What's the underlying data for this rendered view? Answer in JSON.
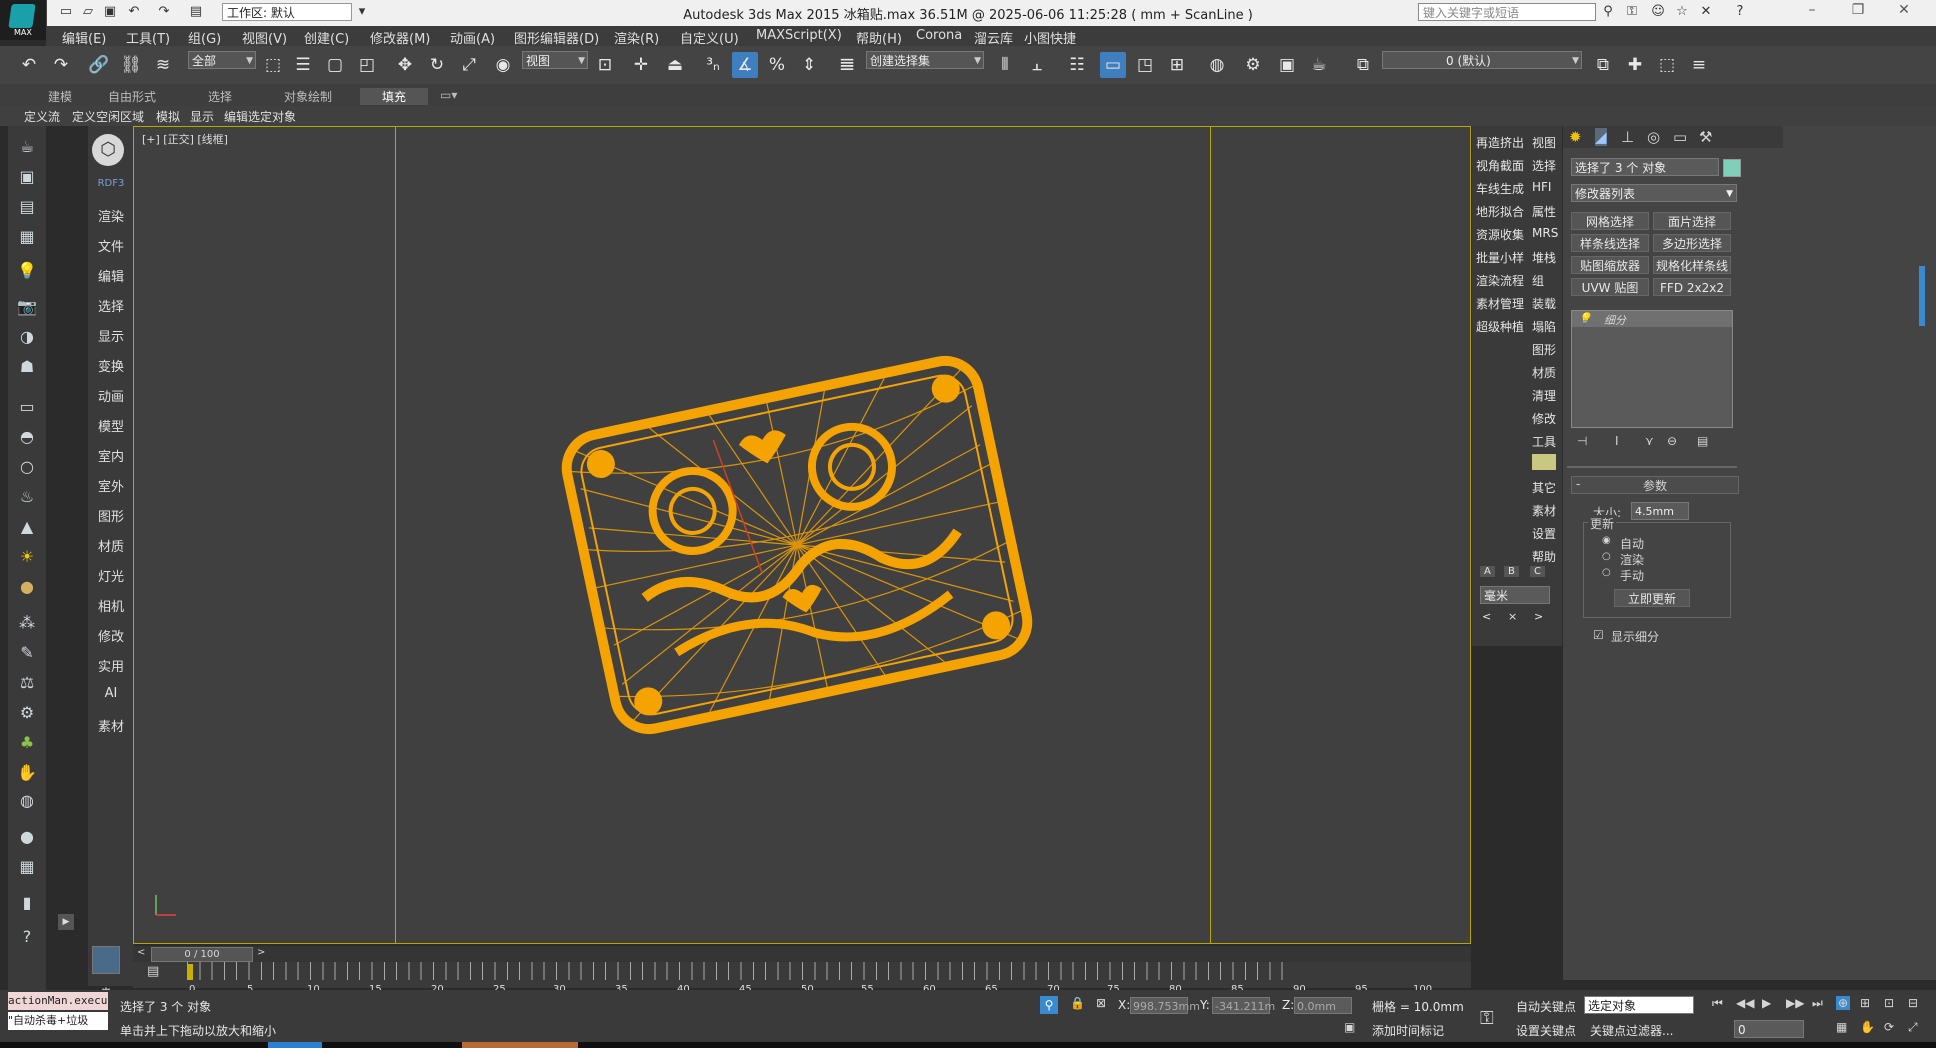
{
  "title_bar": {
    "window_title": "Autodesk 3ds Max  2015     冰箱贴.max  36.51M @ 2025-06-06 11:25:28  ( mm + ScanLine )",
    "workspace": "工作区: 默认",
    "search_placeholder": "键入关键字或短语"
  },
  "menu": [
    "编辑(E)",
    "工具(T)",
    "组(G)",
    "视图(V)",
    "创建(C)",
    "修改器(M)",
    "动画(A)",
    "图形编辑器(D)",
    "渲染(R)",
    "自定义(U)",
    "MAXScript(X)",
    "帮助(H)",
    "Corona",
    "溜云库",
    "小图快捷"
  ],
  "toolbar": {
    "selection_filter": "全部",
    "ref_coord": "视图",
    "named_selection": "创建选择集",
    "layer": "0 (默认)"
  },
  "ribbon_tabs": [
    "建模",
    "自由形式",
    "选择",
    "对象绘制",
    "填充"
  ],
  "ribbon_sub": [
    "定义流",
    "定义空闲区域",
    "模拟",
    "显示",
    "编辑选定对象"
  ],
  "left_vertical": {
    "header": "RDF3",
    "items": [
      "渲染",
      "文件",
      "编辑",
      "选择",
      "显示",
      "变换",
      "动画",
      "模型",
      "室内",
      "室外",
      "图形",
      "材质",
      "灯光",
      "相机",
      "修改",
      "实用",
      "AI",
      "素材"
    ]
  },
  "viewport": {
    "label": "[+] [正交] [线框]",
    "object_color": "#f5a300"
  },
  "command_buttons": {
    "left_col": [
      "再造挤出",
      "视角截面",
      "车线生成",
      "地形拟合",
      "资源收集",
      "批量小样",
      "渲染流程",
      "素材管理",
      "超级种植"
    ],
    "right_col": [
      "视图",
      "选择",
      "HFI",
      "属性",
      "MRS",
      "堆栈",
      "组",
      "装载",
      "塌陷",
      "图形",
      "材质",
      "清理",
      "修改",
      "工具",
      "",
      "其它",
      "素材",
      "设置",
      "帮助"
    ],
    "abc": [
      "A",
      "B",
      "C"
    ],
    "unit": "毫米"
  },
  "modify_panel": {
    "selection_text": "选择了 3 个 对象",
    "modifier_list": "修改器列表",
    "buttons": [
      "网格选择",
      "面片选择",
      "样条线选择",
      "多边形选择",
      "贴图缩放器",
      "规格化样条线",
      "UVW 贴图",
      "FFD 2x2x2"
    ],
    "stack_item": "细分",
    "rollout_title": "参数",
    "size_label": "大小:",
    "size_value": "4.5mm",
    "update_group": "更新",
    "radio_auto": "自动",
    "radio_render": "渲染",
    "radio_manual": "手动",
    "update_now": "立即更新",
    "show_subdiv": "显示细分"
  },
  "timeline": {
    "frame_display": "0 / 100",
    "ticks": [
      "0",
      "5",
      "10",
      "15",
      "20",
      "25",
      "30",
      "35",
      "40",
      "45",
      "50",
      "55",
      "60",
      "65",
      "70",
      "75",
      "80",
      "85",
      "90",
      "95",
      "100"
    ]
  },
  "status": {
    "script_line1": "actionMan.execu",
    "script_line2": "\"自动杀毒+垃圾",
    "selected": "选择了 3 个 对象",
    "prompt": "单击并上下拖动以放大和缩小",
    "x_label": "X:",
    "x_value": "998.753mm",
    "y_label": "Y:",
    "y_value": "-341.211m",
    "z_label": "Z:",
    "z_value": "0.0mm",
    "grid": "栅格 = 10.0mm",
    "add_time_tag": "添加时间标记",
    "auto_key": "自动关键点",
    "set_key": "设置关键点",
    "key_select": "选定对象",
    "key_filters": "关键点过滤器...",
    "frame": "0"
  }
}
